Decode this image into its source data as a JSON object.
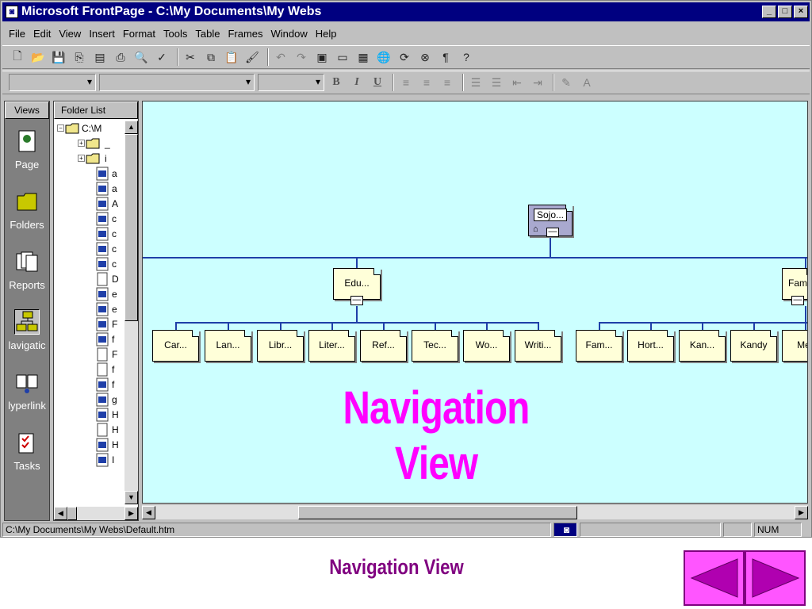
{
  "window": {
    "title": "Microsoft FrontPage - C:\\My Documents\\My Webs",
    "controls": [
      "_",
      "□",
      "×"
    ]
  },
  "menu": [
    "File",
    "Edit",
    "View",
    "Insert",
    "Format",
    "Tools",
    "Table",
    "Frames",
    "Window",
    "Help"
  ],
  "views": {
    "header": "Views",
    "items": [
      {
        "label": "Page",
        "icon": "page-icon"
      },
      {
        "label": "Folders",
        "icon": "folders-icon"
      },
      {
        "label": "Reports",
        "icon": "reports-icon"
      },
      {
        "label": "lavigatic",
        "icon": "navigation-icon",
        "selected": true
      },
      {
        "label": "lyperlink",
        "icon": "hyperlinks-icon"
      },
      {
        "label": "Tasks",
        "icon": "tasks-icon"
      }
    ]
  },
  "folderlist": {
    "header": "Folder List",
    "root": "C:\\M",
    "items": [
      "_",
      "i",
      "a",
      "a",
      "A",
      "c",
      "c",
      "c",
      "c",
      "D",
      "e",
      "e",
      "F",
      "f",
      "F",
      "f",
      "f",
      "g",
      "H",
      "H",
      "H",
      "I"
    ]
  },
  "nav": {
    "root": "Sojo...",
    "level1": [
      "Edu...",
      "Fam"
    ],
    "edu_children": [
      "Car...",
      "Lan...",
      "Libr...",
      "Liter...",
      "Ref...",
      "Tec...",
      "Wo...",
      "Writi..."
    ],
    "fam_children": [
      "Fam...",
      "Hort...",
      "Kan...",
      "Kandy",
      "Mer"
    ]
  },
  "overlay_text": [
    "Navigation",
    "View"
  ],
  "status": {
    "path": "C:\\My Documents\\My Webs\\Default.htm",
    "num": "NUM"
  },
  "caption": "Navigation View",
  "colors": {
    "titlebar": "#000080",
    "canvas": "#ccffff",
    "node": "#ffffd9",
    "overlay": "#ff00ff",
    "caption": "#800080",
    "navbtn": "#ff55ff"
  }
}
